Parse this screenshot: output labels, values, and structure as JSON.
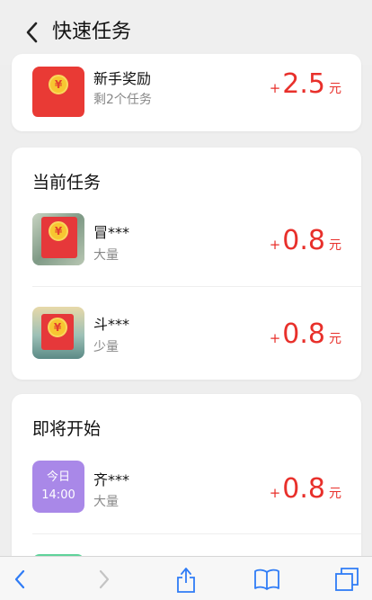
{
  "header": {
    "title": "快速任务"
  },
  "newbie": {
    "name": "新手奖励",
    "sub": "剩2个任务",
    "reward": {
      "plus": "+",
      "amount": "2.5",
      "unit": "元"
    }
  },
  "current": {
    "title": "当前任务",
    "items": [
      {
        "name": "冒***",
        "sub": "大量",
        "reward": {
          "plus": "+",
          "amount": "0.8",
          "unit": "元"
        }
      },
      {
        "name": "斗***",
        "sub": "少量",
        "reward": {
          "plus": "+",
          "amount": "0.8",
          "unit": "元"
        }
      }
    ]
  },
  "upcoming": {
    "title": "即将开始",
    "items": [
      {
        "badge_day": "今日",
        "badge_time": "14:00",
        "name": "齐***",
        "sub": "大量",
        "reward": {
          "plus": "+",
          "amount": "0.8",
          "unit": "元"
        }
      }
    ]
  },
  "icons": {
    "coin": "¥",
    "back": "chevron-left-icon",
    "toolbar": [
      "back-arrow-icon",
      "forward-arrow-icon",
      "share-icon",
      "bookmarks-icon",
      "tabs-icon"
    ]
  },
  "colors": {
    "accent": "#e8302b",
    "browser_blue": "#2f7cf6",
    "badge_purple": "#a988e8"
  }
}
